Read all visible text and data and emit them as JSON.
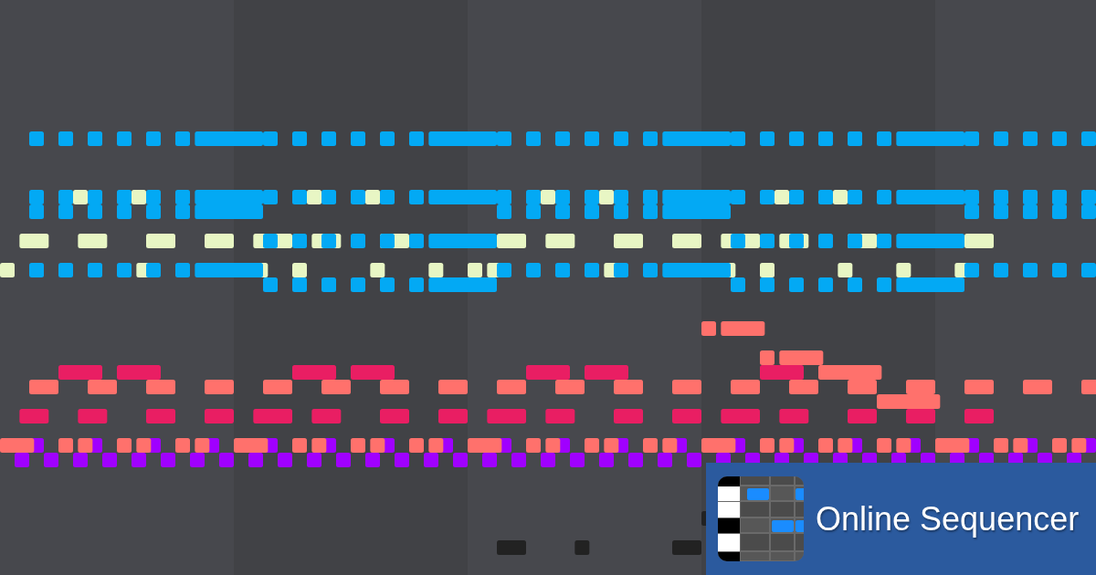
{
  "banner": {
    "title": "Online Sequencer"
  }
}
